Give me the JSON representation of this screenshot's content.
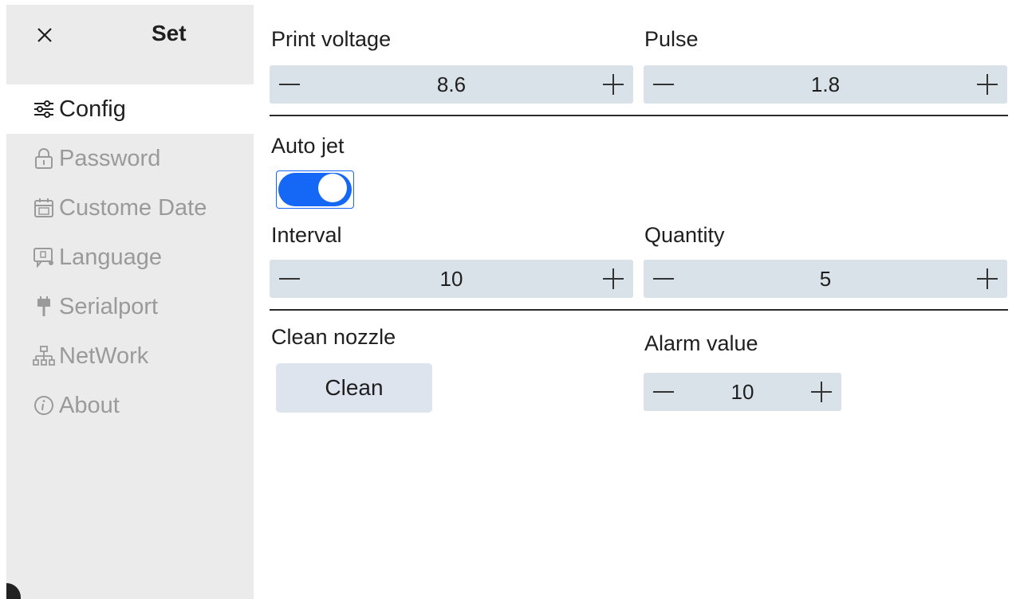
{
  "sidebar": {
    "title": "Set",
    "items": [
      {
        "label": "Config",
        "icon": "sliders-icon",
        "active": true
      },
      {
        "label": "Password",
        "icon": "lock-icon",
        "active": false
      },
      {
        "label": "Custome Date",
        "icon": "calendar-icon",
        "active": false
      },
      {
        "label": "Language",
        "icon": "language-icon",
        "active": false
      },
      {
        "label": "Serialport",
        "icon": "plug-icon",
        "active": false
      },
      {
        "label": "NetWork",
        "icon": "network-icon",
        "active": false
      },
      {
        "label": "About",
        "icon": "info-icon",
        "active": false
      }
    ]
  },
  "config": {
    "print_voltage": {
      "label": "Print voltage",
      "value": "8.6"
    },
    "pulse": {
      "label": "Pulse",
      "value": "1.8"
    },
    "auto_jet": {
      "label": "Auto jet",
      "on": true
    },
    "interval": {
      "label": "Interval",
      "value": "10"
    },
    "quantity": {
      "label": "Quantity",
      "value": "5"
    },
    "clean_nozzle": {
      "label": "Clean nozzle",
      "button": "Clean"
    },
    "alarm_value": {
      "label": "Alarm value",
      "value": "10"
    }
  },
  "colors": {
    "accent": "#1468f5",
    "stepper_bg": "#d9e2e8",
    "sidebar_bg": "#ebebeb",
    "inactive_text": "#9a9a9a"
  }
}
